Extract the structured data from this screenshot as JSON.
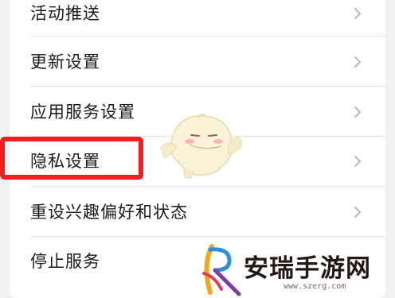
{
  "settings": {
    "items": [
      {
        "label": "活动推送"
      },
      {
        "label": "更新设置"
      },
      {
        "label": "应用服务设置"
      },
      {
        "label": "隐私设置"
      },
      {
        "label": "重设兴趣偏好和状态"
      },
      {
        "label": "停止服务"
      }
    ],
    "highlighted_item": "隐私设置"
  },
  "watermark": {
    "title": "安瑞手游网",
    "url": "www.szerg.com"
  },
  "colors": {
    "highlight": "#f01e1e",
    "chevron": "#b8b8b8",
    "background": "#f2f2f4"
  },
  "icons": {
    "chevron": "chevron-right-icon",
    "mascot": "mascot-sticker",
    "logo": "site-logo-icon"
  }
}
